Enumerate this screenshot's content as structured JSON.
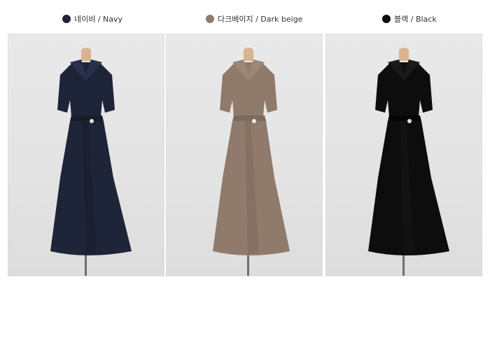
{
  "variants": [
    {
      "label": "네이비 / Navy",
      "color": "#1f2538"
    },
    {
      "label": "다크베이지 / Dark beige",
      "color": "#8f7a6b"
    },
    {
      "label": "블랙 / Black",
      "color": "#0d0d0d"
    }
  ]
}
